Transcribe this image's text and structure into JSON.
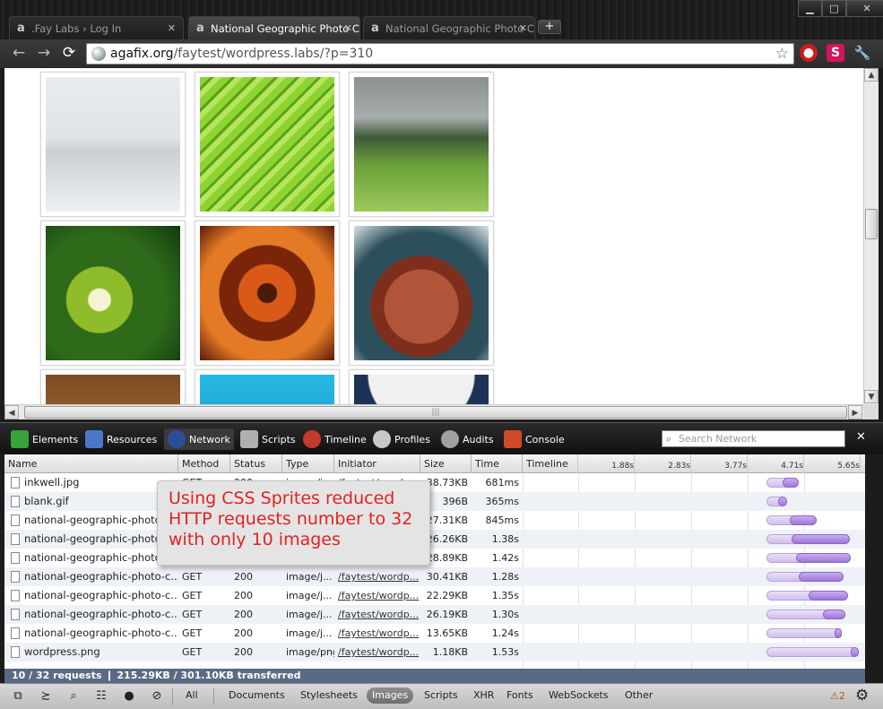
{
  "window": {
    "minimize": "▁",
    "maximize": "□",
    "close": "✕"
  },
  "tabs": [
    {
      "favicon": "a",
      "label": ".Fay Labs › Log In",
      "close": "✕",
      "active": false
    },
    {
      "favicon": "a",
      "label": "National Geographic Photo Cor",
      "close": "✕",
      "active": true
    },
    {
      "favicon": "a",
      "label": "National Geographic Photo Cor",
      "close": "✕",
      "active": false
    }
  ],
  "newtab_label": "+",
  "toolbar": {
    "back": "←",
    "forward": "→",
    "reload": "⟳",
    "url_host": "agafix.org",
    "url_path": "/faytest/wordpress.labs/?p=310",
    "star": "☆",
    "ext1": "●",
    "ext2": "S",
    "wrench": "🔧"
  },
  "photos": [
    {
      "name": "snowy-dunes",
      "bg": "linear-gradient(#e9ecee 0%, #dfe4e7 45%, #c9d0d4 55%, #eef0f1 100%)"
    },
    {
      "name": "green-palm-leaf",
      "bg": "repeating-linear-gradient(135deg, #8cd433 0 8px, #5aa11d 8px 11px, #b6e65a 11px 17px)"
    },
    {
      "name": "rainy-field",
      "bg": "linear-gradient(#8a9191 0%, #a7adac 30%, #3f5a3a 45%, #6aa03a 65%, #9cc95a 100%)"
    },
    {
      "name": "lizard-flowers",
      "bg": "radial-gradient(circle at 40% 55%, #f4f4d2 0 10%, #8fbc2a 11% 30%, #2e6a1a 31% 60%, #123a10 100%)"
    },
    {
      "name": "starfish",
      "bg": "radial-gradient(circle at 50% 50%, #4a1a08 0 10%, #d95a18 11% 30%, #7a240a 31% 50%, #e47a26 51% 70%, #5a1a08 100%)"
    },
    {
      "name": "red-rock",
      "bg": "radial-gradient(circle at 50% 60%, #b0553a 0 35%, #7d2e1d 36% 48%, #2c4f5c 49% 70%, #d9e4e6 100%)"
    },
    {
      "name": "brown-photo",
      "bg": "linear-gradient(#7a4a22, #c79550)"
    },
    {
      "name": "blue-water",
      "bg": "linear-gradient(#27b9e3, #0a7fb5)"
    },
    {
      "name": "dark-blue",
      "bg": "radial-gradient(circle at 50% 0%, #f0f0f0 0 35%, #1d3356 36%)"
    }
  ],
  "devtools": {
    "panels": [
      "Elements",
      "Resources",
      "Network",
      "Scripts",
      "Timeline",
      "Profiles",
      "Audits",
      "Console"
    ],
    "panel_colors": [
      "#3aa23a",
      "#4a78c8",
      "#2a4f9a",
      "#b0b0b0",
      "#c23a2a",
      "#c8c8c8",
      "#a0a0a0",
      "#d04a2a"
    ],
    "search_placeholder": "Search Network",
    "close": "✕",
    "columns": [
      "Name",
      "Method",
      "Status",
      "Type",
      "Initiator",
      "Size",
      "Time",
      "Timeline"
    ],
    "ticks": [
      "1.88s",
      "2.83s",
      "3.77s",
      "4.71s",
      "5.65s"
    ],
    "rows": [
      {
        "name": "inkwell.jpg",
        "method": "GET",
        "status": "200",
        "type": "image/j...",
        "initiator": "/faytest/wordp...",
        "size": "38.73KB",
        "time": "681ms",
        "start": 5.02,
        "recv": 5.28,
        "end": 5.55
      },
      {
        "name": "blank.gif",
        "method": "",
        "status": "",
        "type": "",
        "initiator": "",
        "size": "396B",
        "time": "365ms",
        "start": 5.02,
        "recv": 5.2,
        "end": 5.35
      },
      {
        "name": "national-geographic-photo",
        "method": "",
        "status": "",
        "type": "",
        "initiator": "",
        "size": "27.31KB",
        "time": "845ms",
        "start": 5.02,
        "recv": 5.4,
        "end": 5.85
      },
      {
        "name": "national-geographic-photo",
        "method": "",
        "status": "",
        "type": "",
        "initiator": "",
        "size": "26.26KB",
        "time": "1.38s",
        "start": 5.02,
        "recv": 5.43,
        "end": 6.4
      },
      {
        "name": "national-geographic-photo",
        "method": "",
        "status": "",
        "type": "",
        "initiator": "",
        "size": "28.89KB",
        "time": "1.42s",
        "start": 5.02,
        "recv": 5.5,
        "end": 6.42
      },
      {
        "name": "national-geographic-photo-c...",
        "method": "GET",
        "status": "200",
        "type": "image/j...",
        "initiator": "/faytest/wordp...",
        "size": "30.41KB",
        "time": "1.28s",
        "start": 5.02,
        "recv": 5.55,
        "end": 6.3
      },
      {
        "name": "national-geographic-photo-c...",
        "method": "GET",
        "status": "200",
        "type": "image/j...",
        "initiator": "/faytest/wordp...",
        "size": "22.29KB",
        "time": "1.35s",
        "start": 5.02,
        "recv": 5.72,
        "end": 6.37
      },
      {
        "name": "national-geographic-photo-c...",
        "method": "GET",
        "status": "200",
        "type": "image/j...",
        "initiator": "/faytest/wordp...",
        "size": "26.19KB",
        "time": "1.30s",
        "start": 5.02,
        "recv": 5.95,
        "end": 6.32
      },
      {
        "name": "national-geographic-photo-c...",
        "method": "GET",
        "status": "200",
        "type": "image/j...",
        "initiator": "/faytest/wordp...",
        "size": "13.65KB",
        "time": "1.24s",
        "start": 5.02,
        "recv": 6.15,
        "end": 6.26
      },
      {
        "name": "wordpress.png",
        "method": "GET",
        "status": "200",
        "type": "image/png",
        "initiator": "/faytest/wordp...",
        "size": "1.18KB",
        "time": "1.53s",
        "start": 5.02,
        "recv": 6.42,
        "end": 6.55
      }
    ],
    "load_event_time": 6.68,
    "status": "10 / 32 requests  ❙  215.29KB / 301.10KB transferred",
    "bottom_icons": [
      "⧉",
      "≿",
      "⌕",
      "☷",
      "●",
      "⊘"
    ],
    "filters": [
      "All",
      "Documents",
      "Stylesheets",
      "Images",
      "Scripts",
      "XHR",
      "Fonts",
      "WebSockets",
      "Other"
    ],
    "selected_filter": "Images",
    "warnings": "⚠2",
    "gear": "⚙"
  },
  "callout": "Using CSS Sprites reduced HTTP requests number to 32 with only 10 images"
}
